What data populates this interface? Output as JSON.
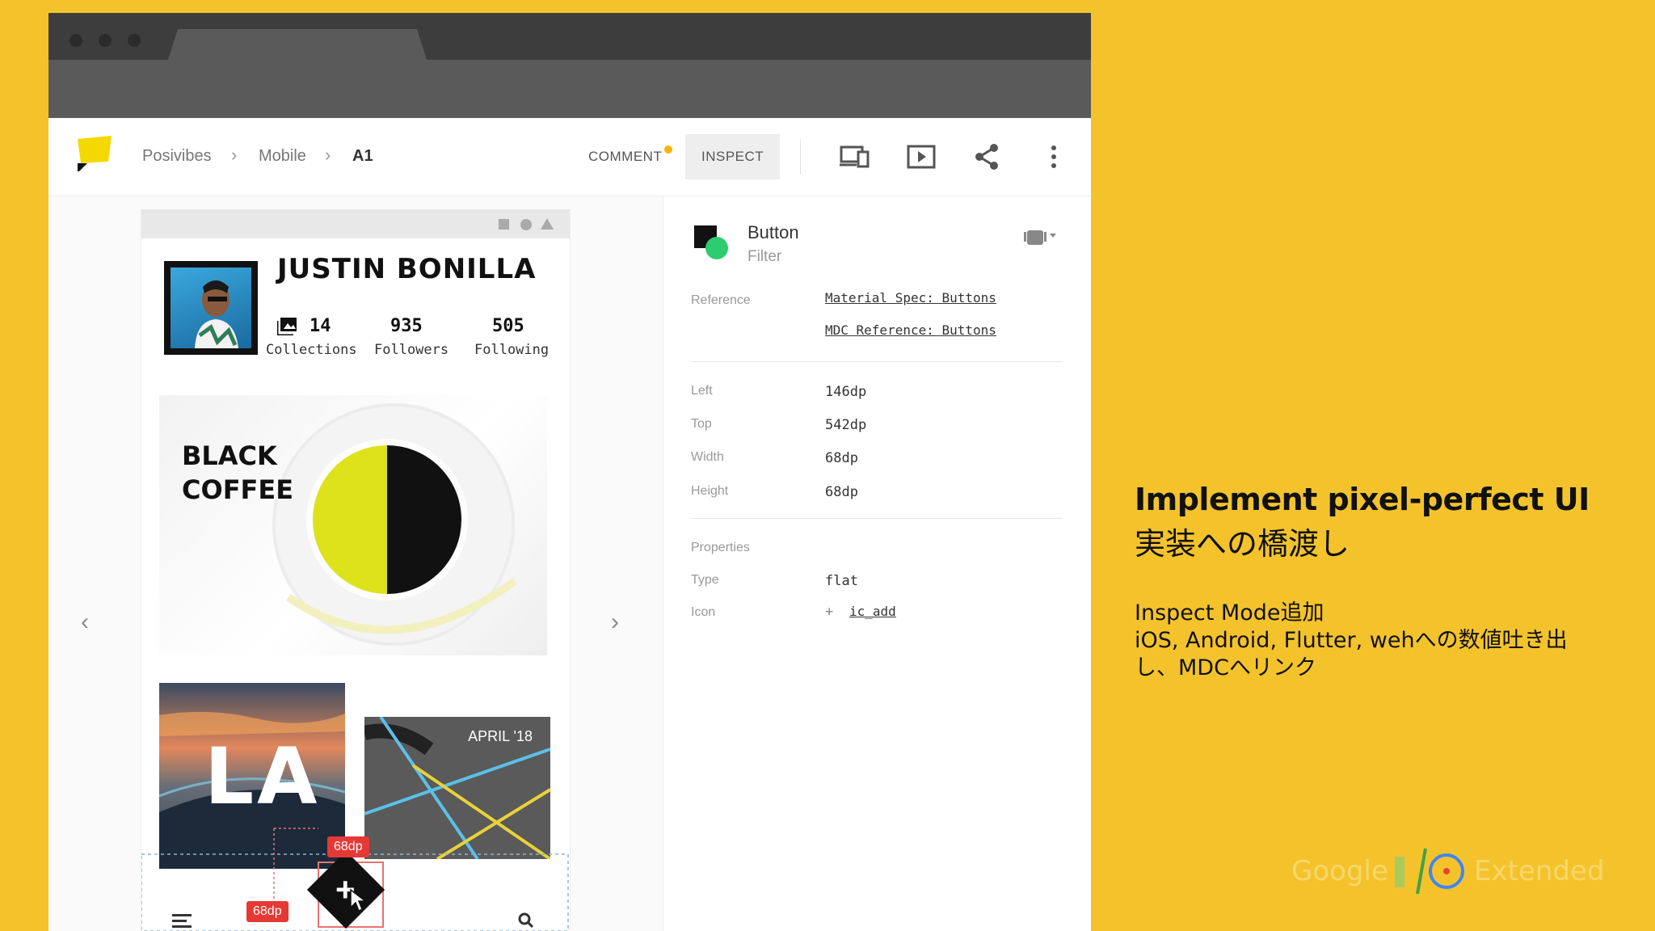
{
  "breadcrumb": [
    "Posivibes",
    "Mobile",
    "A1"
  ],
  "toolbar": {
    "comment_label": "COMMENT",
    "inspect_label": "INSPECT"
  },
  "profile": {
    "name": "JUSTIN BONILLA",
    "stats": [
      {
        "value": "14",
        "label": "Collections"
      },
      {
        "value": "935",
        "label": "Followers"
      },
      {
        "value": "505",
        "label": "Following"
      }
    ]
  },
  "cards": {
    "coffee_line1": "BLACK",
    "coffee_line2": "COFFEE",
    "la_label": "LA",
    "april_label": "APRIL '18"
  },
  "measurements": {
    "width_label": "68dp",
    "height_label": "68dp"
  },
  "inspector": {
    "component": "Button",
    "variant": "Filter",
    "reference_label": "Reference",
    "links": [
      "Material Spec: Buttons",
      "MDC Reference: Buttons"
    ],
    "dimensions": [
      {
        "label": "Left",
        "value": "146dp"
      },
      {
        "label": "Top",
        "value": "542dp"
      },
      {
        "label": "Width",
        "value": "68dp"
      },
      {
        "label": "Height",
        "value": "68dp"
      }
    ],
    "properties_label": "Properties",
    "properties": [
      {
        "label": "Type",
        "value": "flat"
      },
      {
        "label": "Icon",
        "value": "ic_add"
      }
    ]
  },
  "slide": {
    "title": "Implement pixel-perfect UI",
    "subtitle": "実装への橋渡し",
    "body_lines": [
      "Inspect Mode追加",
      "iOS, Android, Flutter, wehへの数値吐き出",
      "し、MDCへリンク"
    ]
  },
  "branding": {
    "google": "Google",
    "extended": "Extended"
  },
  "colors": {
    "background": "#f4c32c",
    "accent_red": "#e53935",
    "brand_yellow": "#f5d800"
  }
}
